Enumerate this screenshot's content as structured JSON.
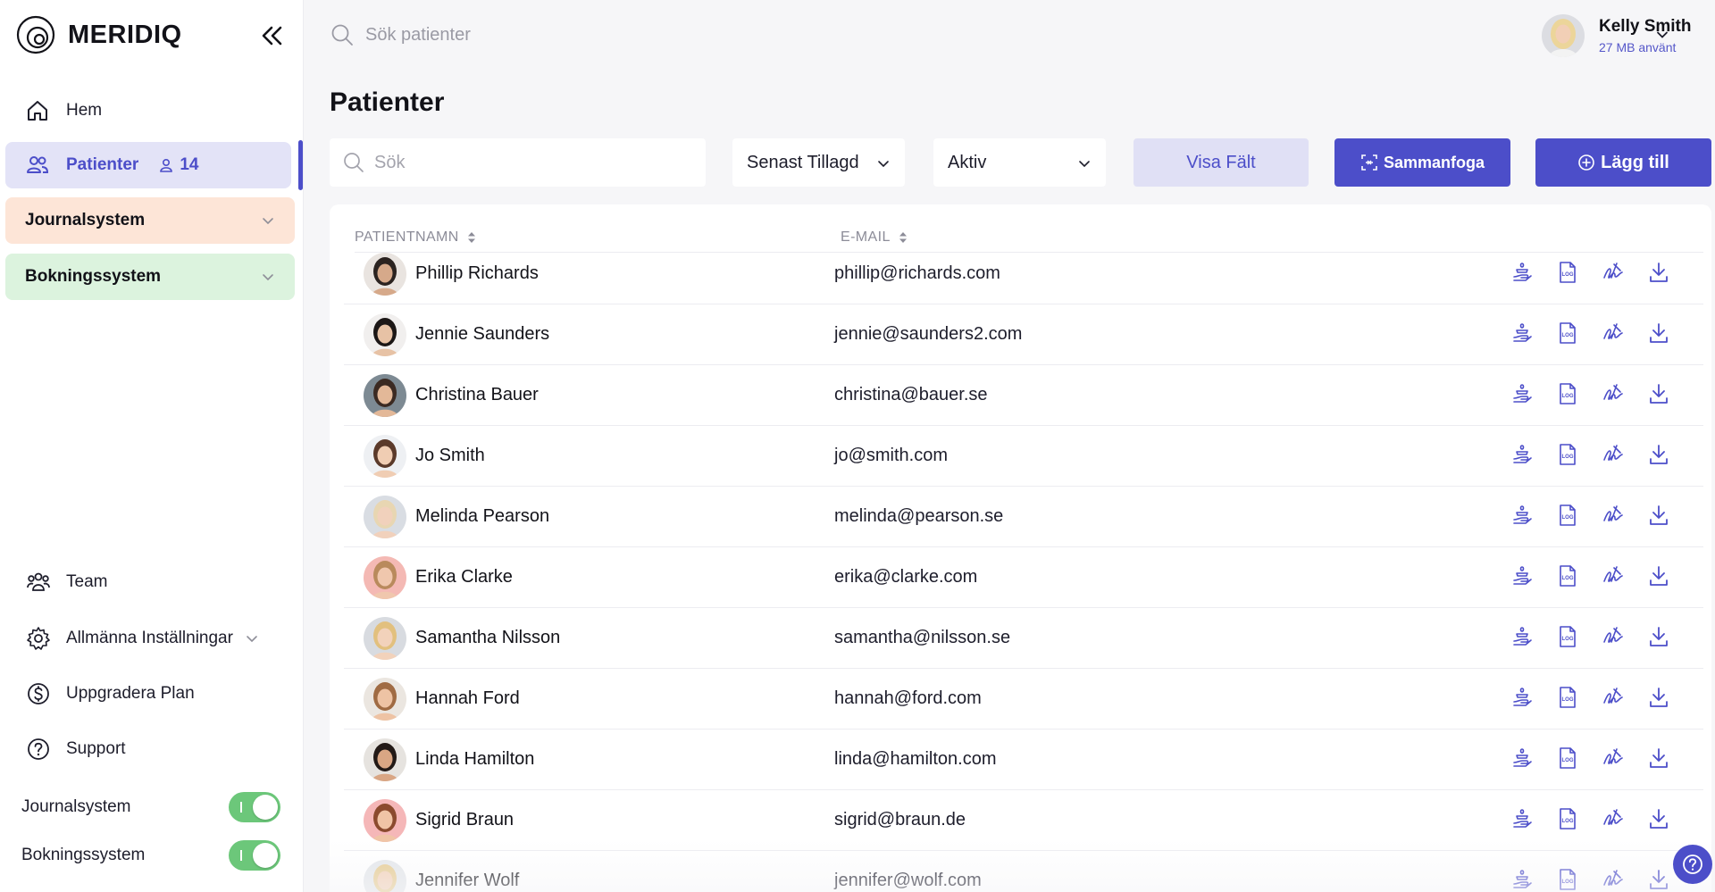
{
  "brand": {
    "name": "MERIDIQ"
  },
  "colors": {
    "accent": "#4c4ec9",
    "journal_bg": "#fde5d7",
    "booking_bg": "#dcf3de",
    "toggle_on": "#6cc77a"
  },
  "sidebar": {
    "home_label": "Hem",
    "patients_label": "Patienter",
    "patients_count": "14",
    "groups": [
      {
        "label": "Journalsystem"
      },
      {
        "label": "Bokningssystem"
      }
    ],
    "bottom": [
      {
        "label": "Team",
        "icon": "team-icon"
      },
      {
        "label": "Allmänna Inställningar",
        "icon": "gear-icon"
      },
      {
        "label": "Uppgradera Plan",
        "icon": "dollar-icon"
      },
      {
        "label": "Support",
        "icon": "question-icon"
      }
    ],
    "toggles": [
      {
        "label": "Journalsystem",
        "on": true
      },
      {
        "label": "Bokningssystem",
        "on": true
      }
    ]
  },
  "topbar": {
    "search_placeholder": "Sök patienter",
    "user_name": "Kelly Smith",
    "user_usage": "27 MB använt"
  },
  "page": {
    "title": "Patienter"
  },
  "toolbar": {
    "search_placeholder": "Sök",
    "sort_value": "Senast Tillagd",
    "status_value": "Aktiv",
    "fields_label": "Visa Fält",
    "merge_label": "Sammanfoga",
    "add_label": "Lägg till"
  },
  "table": {
    "columns": [
      "PATIENTNAMN",
      "E-MAIL"
    ],
    "rows": [
      {
        "name": "Phillip Richards",
        "email": "phillip@richards.com",
        "skin": "#d6a98a",
        "hair": "#2b2320",
        "bg": "#e9e4e0"
      },
      {
        "name": "Jennie Saunders",
        "email": "jennie@saunders2.com",
        "skin": "#e7c2a5",
        "hair": "#1c1716",
        "bg": "#f1efee"
      },
      {
        "name": "Christina Bauer",
        "email": "christina@bauer.se",
        "skin": "#e3b898",
        "hair": "#3b2a22",
        "bg": "#7d8a93"
      },
      {
        "name": "Jo Smith",
        "email": "jo@smith.com",
        "skin": "#f0cdb3",
        "hair": "#5b3a2a",
        "bg": "#eef0f3"
      },
      {
        "name": "Melinda Pearson",
        "email": "melinda@pearson.se",
        "skin": "#f1d1bc",
        "hair": "#e8d6b2",
        "bg": "#d9dde3"
      },
      {
        "name": "Erika Clarke",
        "email": "erika@clarke.com",
        "skin": "#f0c7ad",
        "hair": "#b98a5c",
        "bg": "#f4b9b4"
      },
      {
        "name": "Samantha Nilsson",
        "email": "samantha@nilsson.se",
        "skin": "#f2d2bb",
        "hair": "#e2c07e",
        "bg": "#d8dbe0"
      },
      {
        "name": "Hannah Ford",
        "email": "hannah@ford.com",
        "skin": "#eec3a4",
        "hair": "#a06b43",
        "bg": "#ebe6e0"
      },
      {
        "name": "Linda Hamilton",
        "email": "linda@hamilton.com",
        "skin": "#d9a684",
        "hair": "#231a17",
        "bg": "#e6e3df"
      },
      {
        "name": "Sigrid Braun",
        "email": "sigrid@braun.de",
        "skin": "#f0c4a6",
        "hair": "#8b4a2e",
        "bg": "#f5b7b8"
      },
      {
        "name": "Jennifer Wolf",
        "email": "jennifer@wolf.com",
        "skin": "#f2cfb5",
        "hair": "#e5c98e",
        "bg": "#e3e6ea"
      }
    ],
    "actions": [
      "consent-icon",
      "log-icon",
      "signature-icon",
      "download-icon"
    ]
  }
}
